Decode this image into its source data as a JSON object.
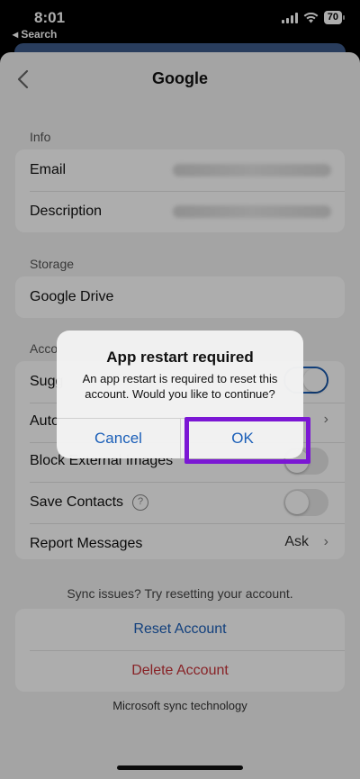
{
  "status_bar": {
    "time": "8:01",
    "back_label": "◂ Search",
    "battery": "70"
  },
  "nav": {
    "title": "Google"
  },
  "info": {
    "section_label": "Info",
    "rows": [
      {
        "label": "Email"
      },
      {
        "label": "Description"
      }
    ]
  },
  "storage": {
    "section_label": "Storage",
    "rows": [
      {
        "label": "Google Drive"
      }
    ]
  },
  "account": {
    "section_label": "Acco",
    "rows": [
      {
        "label": "Sugg",
        "toggle_on": true
      },
      {
        "label": "Auto"
      },
      {
        "label": "Block External Images"
      },
      {
        "label": "Save Contacts",
        "toggle_on": false
      },
      {
        "label": "Report Messages",
        "value": "Ask"
      }
    ]
  },
  "sync_text": "Sync issues? Try resetting your account.",
  "actions": {
    "reset": "Reset Account",
    "delete": "Delete Account"
  },
  "footer_text": "Microsoft sync technology",
  "alert": {
    "title": "App restart required",
    "message": "An app restart is required to reset this account. Would you like to continue?",
    "cancel_label": "Cancel",
    "ok_label": "OK"
  },
  "colors": {
    "accent": "#1b5fb8",
    "destructive": "#c9343a",
    "highlight": "#7b17d4"
  }
}
